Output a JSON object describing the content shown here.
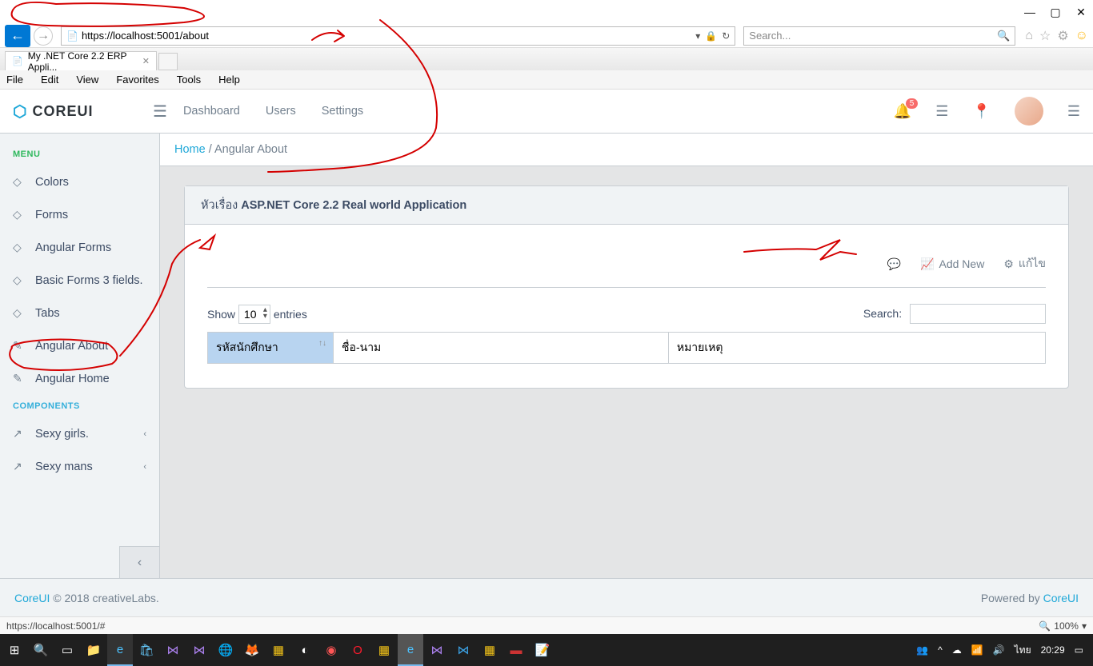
{
  "browser": {
    "url": "https://localhost:5001/about",
    "search_placeholder": "Search...",
    "tab_title": "My .NET Core 2.2 ERP Appli...",
    "menus": [
      "File",
      "Edit",
      "View",
      "Favorites",
      "Tools",
      "Help"
    ],
    "status_url": "https://localhost:5001/#",
    "zoom": "100%"
  },
  "header": {
    "brand": "COREUI",
    "nav": [
      "Dashboard",
      "Users",
      "Settings"
    ],
    "badge": "5"
  },
  "sidebar": {
    "title_menu": "MENU",
    "title_components": "COMPONENTS",
    "items": [
      {
        "label": "Colors",
        "icon": "drop"
      },
      {
        "label": "Forms",
        "icon": "drop"
      },
      {
        "label": "Angular Forms",
        "icon": "drop"
      },
      {
        "label": "Basic Forms 3 fields.",
        "icon": "drop"
      },
      {
        "label": "Tabs",
        "icon": "drop"
      },
      {
        "label": "Angular About",
        "icon": "pencil"
      },
      {
        "label": "Angular Home",
        "icon": "pencil"
      }
    ],
    "components": [
      {
        "label": "Sexy girls."
      },
      {
        "label": "Sexy mans"
      }
    ]
  },
  "breadcrumb": {
    "home": "Home",
    "sep": " / ",
    "current": "Angular About"
  },
  "card": {
    "header_prefix": "หัวเรื่อง ",
    "header_bold": "ASP.NET Core 2.2 Real world Application",
    "actions": {
      "add_new": "Add New",
      "edit": "แก้ไข"
    },
    "dt": {
      "show": "Show",
      "len_val": "10",
      "entries": "entries",
      "search_label": "Search:",
      "cols": [
        "รหัสนักศึกษา",
        "ชื่อ-นาม",
        "หมายเหตุ"
      ]
    }
  },
  "footer": {
    "brand": "CoreUI",
    "copy": " © 2018 creativeLabs.",
    "powered": "Powered by ",
    "powered_link": "CoreUI"
  },
  "taskbar": {
    "lang": "ไทย",
    "time": "20:29"
  }
}
